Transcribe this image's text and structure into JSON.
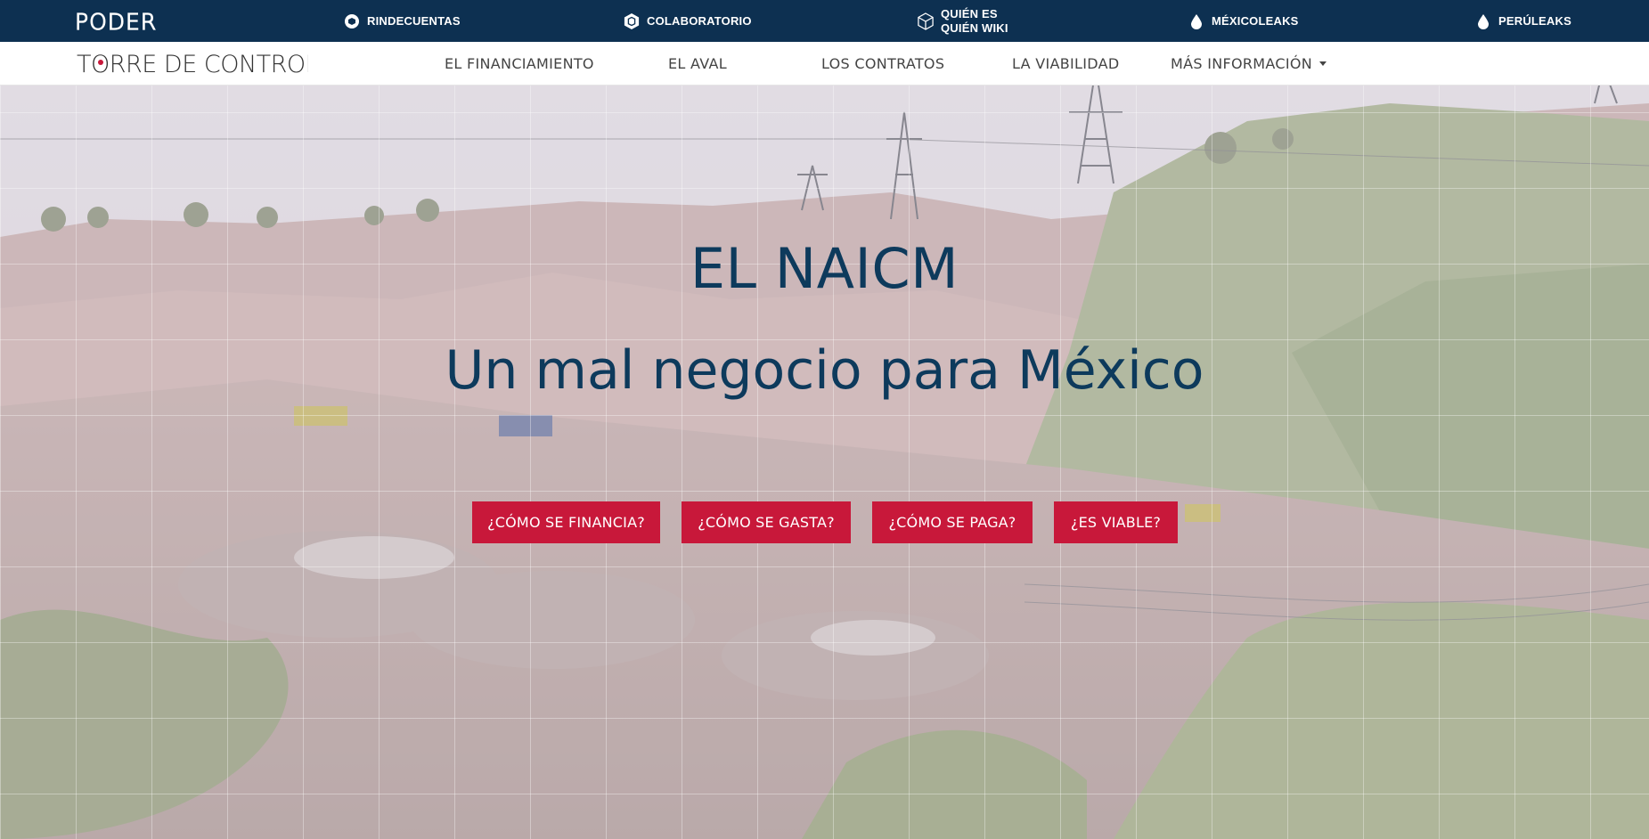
{
  "topbar": {
    "logo": "PODER",
    "links": [
      {
        "label": "RINDECUENTAS",
        "icon": "rindecuentas-icon"
      },
      {
        "label": "COLABORATORIO",
        "icon": "colaboratorio-icon"
      },
      {
        "label_line1": "QUIÉN ES",
        "label_line2": "QUIÉN WIKI",
        "icon": "cube-icon"
      },
      {
        "label": "MÉXICOLEAKS",
        "icon": "drop-icon"
      },
      {
        "label": "PERÚLEAKS",
        "icon": "drop-icon"
      }
    ],
    "background": "#0d3051"
  },
  "navbar": {
    "brand": "TORRE DE CONTROL",
    "items": [
      {
        "label": "EL FINANCIAMIENTO"
      },
      {
        "label": "EL AVAL"
      },
      {
        "label": "LOS CONTRATOS"
      },
      {
        "label": "LA VIABILIDAD"
      },
      {
        "label": "MÁS INFORMACIÓN"
      }
    ]
  },
  "hero": {
    "title": "EL NAICM",
    "subtitle": "Un mal negocio para México",
    "buttons": [
      {
        "label": "¿CÓMO SE FINANCIA?"
      },
      {
        "label": "¿CÓMO SE GASTA?"
      },
      {
        "label": "¿CÓMO SE PAGA?"
      },
      {
        "label": "¿ES VIABLE?"
      }
    ],
    "title_color": "#0d3a5c",
    "button_color": "#c8183a"
  }
}
